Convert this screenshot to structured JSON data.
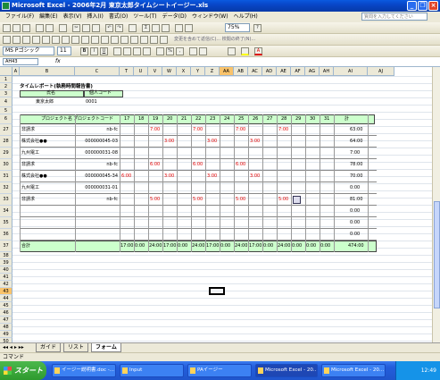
{
  "window": {
    "title": "Microsoft Excel - 2006年2月 東京太郎タイムシートイージー.xls"
  },
  "menu": {
    "items": [
      "ファイル(F)",
      "編集(E)",
      "表示(V)",
      "挿入(I)",
      "書式(O)",
      "ツール(T)",
      "データ(D)",
      "ウィンドウ(W)",
      "ヘルプ(H)"
    ],
    "help_placeholder": "質問を入力してください"
  },
  "toolbar": {
    "zoom": "75%",
    "font_name": "MS Pゴシック",
    "font_size": "11",
    "reply_text": "変更を含めて返信(C)...  校閲の終了(N)..."
  },
  "formula": {
    "namebox": "AH43",
    "fx": "fx"
  },
  "columns": [
    "A",
    "B",
    "C",
    "T",
    "U",
    "V",
    "W",
    "X",
    "Y",
    "Z",
    "AA",
    "AB",
    "AC",
    "AD",
    "AE",
    "AF",
    "AG",
    "AH",
    "AI",
    "AJ"
  ],
  "selected_column": "AA",
  "rows": [
    "1",
    "2",
    "3",
    "4",
    "5",
    "6",
    "27",
    "28",
    "29",
    "30",
    "31",
    "32",
    "33",
    "34",
    "35",
    "36",
    "37",
    "38",
    "39",
    "40",
    "41",
    "42",
    "43",
    "44",
    "45",
    "46",
    "47",
    "48",
    "49",
    "50",
    "51",
    "52"
  ],
  "selected_row": "43",
  "sheet": {
    "title": "タイムレポート(執務時間報告書)",
    "hdr_name": "氏名",
    "hdr_code": "個人コード",
    "name": "東京太郎",
    "code": "0001",
    "col_project": "プロジェクト名",
    "col_pcode": "プロジェクトコード",
    "days": [
      "17",
      "18",
      "19",
      "20",
      "21",
      "22",
      "23",
      "24",
      "25",
      "26",
      "27",
      "28",
      "29",
      "30",
      "31",
      "計"
    ],
    "entries": [
      {
        "name": "非請求",
        "code": "nb-fc",
        "vals": [
          "",
          "",
          "7:00",
          "",
          "",
          "7:00",
          "",
          "",
          "7:00",
          "",
          "",
          "7:00",
          "",
          "",
          ""
        ],
        "total": "63:00"
      },
      {
        "name": "株式会社●●",
        "code": "000000045-03",
        "vals": [
          "",
          "",
          "",
          "3:00",
          "",
          "",
          "3:00",
          "",
          "",
          "3:00",
          "",
          "",
          "",
          "",
          ""
        ],
        "total": "64:00"
      },
      {
        "name": "九州電工",
        "code": "000000031-08",
        "vals": [
          "",
          "",
          "",
          "",
          "",
          "",
          "",
          "",
          "",
          "",
          "",
          "",
          "",
          "",
          ""
        ],
        "total": "7:00"
      },
      {
        "name": "非請求",
        "code": "nb-fc",
        "vals": [
          "",
          "",
          "6:00",
          "",
          "",
          "6:00",
          "",
          "",
          "6:00",
          "",
          "",
          "",
          "",
          "",
          ""
        ],
        "total": "78:00"
      },
      {
        "name": "株式会社●●",
        "code": "000000045-34",
        "vals": [
          "6:00",
          "",
          "",
          "3:00",
          "",
          "",
          "3:00",
          "",
          "",
          "3:00",
          "",
          "",
          "",
          "",
          ""
        ],
        "total": "70:00"
      },
      {
        "name": "九州電工",
        "code": "000000031-01",
        "vals": [
          "",
          "",
          "",
          "",
          "",
          "",
          "",
          "",
          "",
          "",
          "",
          "",
          "",
          "",
          ""
        ],
        "total": "0:00"
      },
      {
        "name": "非請求",
        "code": "nb-fc",
        "vals": [
          "",
          "",
          "5:00",
          "",
          "",
          "5:00",
          "",
          "",
          "5:00",
          "",
          "",
          "5:00",
          "",
          "",
          ""
        ],
        "total": "81:00"
      },
      {
        "name": "",
        "code": "",
        "vals": [
          "",
          "",
          "",
          "",
          "",
          "",
          "",
          "",
          "",
          "",
          "",
          "",
          "",
          "",
          ""
        ],
        "total": "0:00"
      },
      {
        "name": "",
        "code": "",
        "vals": [
          "",
          "",
          "",
          "",
          "",
          "",
          "",
          "",
          "",
          "",
          "",
          "",
          "",
          "",
          ""
        ],
        "total": "0:00"
      },
      {
        "name": "",
        "code": "",
        "vals": [
          "",
          "",
          "",
          "",
          "",
          "",
          "",
          "",
          "",
          "",
          "",
          "",
          "",
          "",
          ""
        ],
        "total": "0:00"
      }
    ],
    "total_label": "合計",
    "totals": [
      "17:00",
      "0:00",
      "24:00",
      "17:00",
      "0:00",
      "24:00",
      "17:00",
      "0:00",
      "24:00",
      "17:00",
      "0:00",
      "24:00",
      "0:00",
      "0:00",
      "0:00"
    ],
    "grand_total": "474:00"
  },
  "tabs": {
    "items": [
      "ガイド",
      "リスト",
      "フォーム"
    ],
    "active": 2
  },
  "status": "コマンド",
  "taskbar": {
    "start": "スタート",
    "tasks": [
      "イージー説明書.doc -...",
      "Input",
      "PAイージー",
      "Microsoft Excel - 20...",
      "Microsoft Excel - 20..."
    ],
    "clock": "12:49"
  }
}
